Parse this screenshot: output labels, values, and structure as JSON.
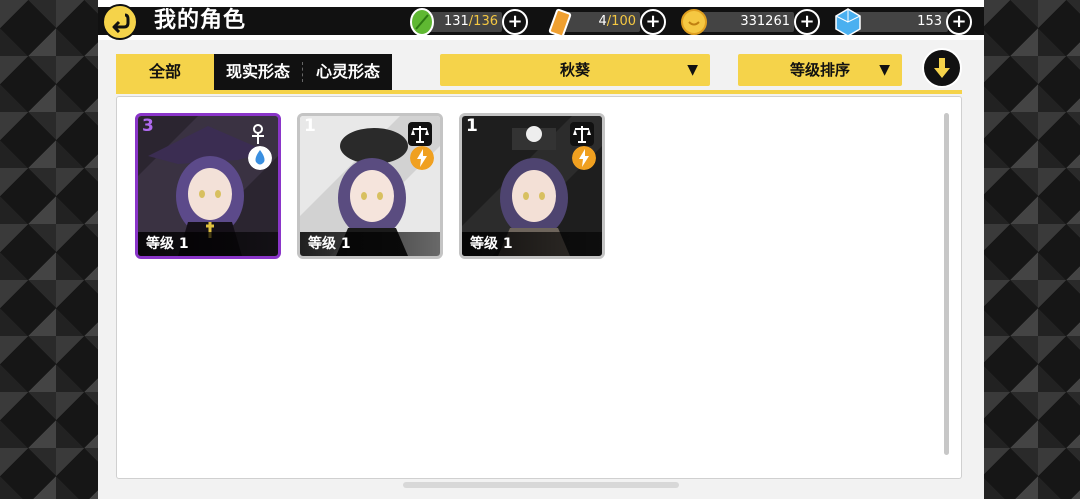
{
  "header": {
    "title": "我的角色"
  },
  "resources": {
    "stamina": {
      "current": "131",
      "max": "/136"
    },
    "battery": {
      "current": "4",
      "max": "/100"
    },
    "coins": {
      "value": "331261"
    },
    "gems": {
      "value": "153"
    }
  },
  "filters": {
    "tabs": [
      "全部",
      "现实形态",
      "心灵形态"
    ],
    "character_select": "秋葵",
    "sort_select": "等级排序"
  },
  "cards": [
    {
      "rank": "3",
      "level": "等级 1",
      "rarity": "purple",
      "attribute_icon": "ankh-icon",
      "element_icon": "water-drop-icon"
    },
    {
      "rank": "1",
      "level": "等级 1",
      "rarity": "gray",
      "attribute_icon": "scales-icon",
      "element_icon": "lightning-icon"
    },
    {
      "rank": "1",
      "level": "等级 1",
      "rarity": "gray",
      "attribute_icon": "scales-icon",
      "element_icon": "lightning-icon"
    }
  ],
  "colors": {
    "accent_yellow": "#f5d34a",
    "rarity_purple": "#8a35c9",
    "lightning_orange": "#f0a020",
    "water_blue": "#3a8fe0"
  }
}
